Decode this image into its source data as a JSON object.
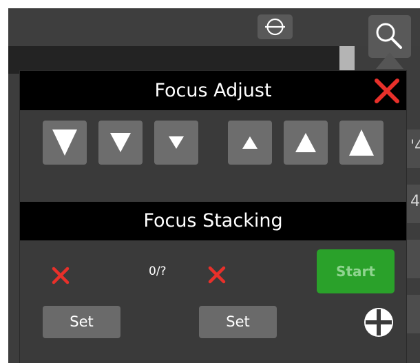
{
  "background": {
    "edge_fragments": [
      "'4",
      "4"
    ]
  },
  "toolbar": {
    "level_icon": "circle-crosshair-icon",
    "search_icon": "magnifier-icon"
  },
  "focus_adjust": {
    "title": "Focus Adjust",
    "close_icon": "close-x-icon",
    "buttons": [
      {
        "name": "focus-down-large-button",
        "icon": "triangle-down-large-icon"
      },
      {
        "name": "focus-down-medium-button",
        "icon": "triangle-down-medium-icon"
      },
      {
        "name": "focus-down-small-button",
        "icon": "triangle-down-small-icon"
      },
      {
        "name": "focus-up-small-button",
        "icon": "triangle-up-small-icon"
      },
      {
        "name": "focus-up-medium-button",
        "icon": "triangle-up-medium-icon"
      },
      {
        "name": "focus-up-large-button",
        "icon": "triangle-up-large-icon"
      }
    ]
  },
  "focus_stacking": {
    "title": "Focus Stacking",
    "counter": "0/?",
    "start_label": "Start",
    "set_near_label": "Set",
    "set_far_label": "Set",
    "clear_icon": "red-x-icon",
    "add_icon": "circle-plus-icon"
  },
  "colors": {
    "close_red": "#e8302a",
    "start_green": "#2aa12a",
    "start_text": "#8fd48f",
    "header_black": "#000000",
    "panel_grey": "#3e3e3e",
    "button_grey": "#6d6d6d"
  }
}
